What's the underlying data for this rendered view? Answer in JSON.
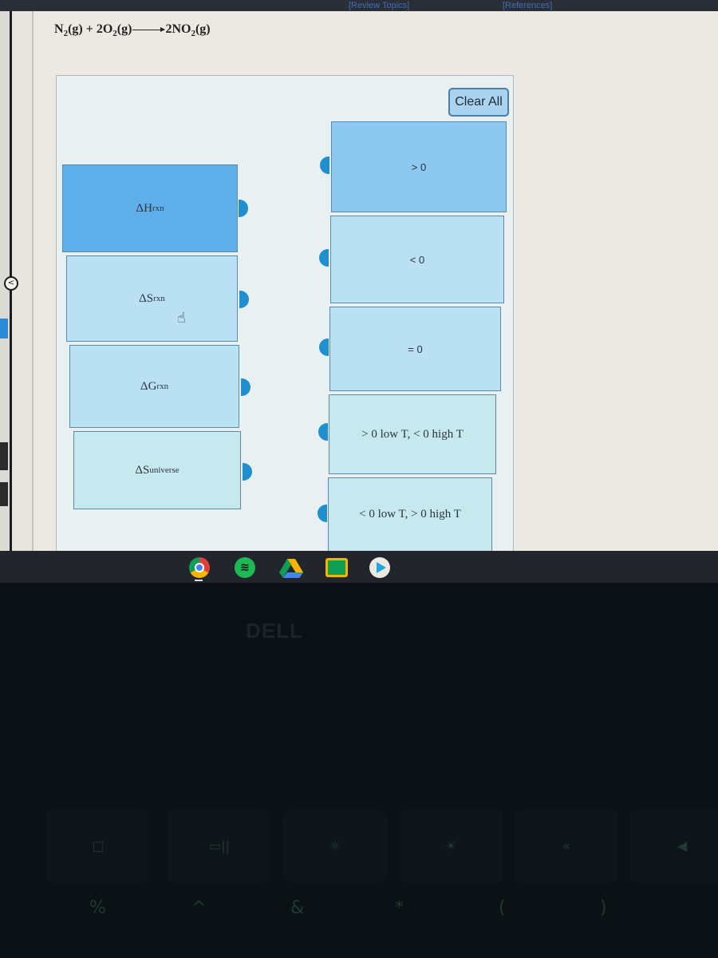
{
  "header": {
    "review_topics": "[Review Topics]",
    "references": "[References]"
  },
  "sidebar": {
    "collapse_label": "<"
  },
  "question": {
    "reactant1": "N",
    "reactant1_sub": "2",
    "reactant1_state": "(g) + 2O",
    "reactant2_sub": "2",
    "reactant2_state": "(g)",
    "product_prefix": "2NO",
    "product_sub": "2",
    "product_state": "(g)"
  },
  "matching": {
    "clear_all_label": "Clear All",
    "left_items": [
      {
        "symbol": "ΔH",
        "sub": "rxn",
        "selected": true
      },
      {
        "symbol": "ΔS",
        "sub": "rxn",
        "selected": false
      },
      {
        "symbol": "ΔG",
        "sub": "rxn",
        "selected": false
      },
      {
        "symbol": "ΔS",
        "sub": "universe",
        "selected": false
      }
    ],
    "right_items": [
      {
        "label": "> 0"
      },
      {
        "label": "< 0"
      },
      {
        "label": "= 0"
      },
      {
        "label": "> 0 low T, < 0 high T"
      },
      {
        "label": "< 0 low T, > 0 high T"
      }
    ]
  },
  "shelf": {
    "apps": [
      "chrome-icon",
      "spotify-icon",
      "google-drive-icon",
      "google-classroom-icon",
      "play-store-icon"
    ]
  },
  "bezel": {
    "brand": "DELL",
    "keys_fn": [
      "□",
      "▭||",
      "☼",
      "☀",
      "«",
      "◀"
    ],
    "keys_sym": [
      "%",
      "^",
      "&",
      "*",
      "(",
      ")"
    ]
  }
}
